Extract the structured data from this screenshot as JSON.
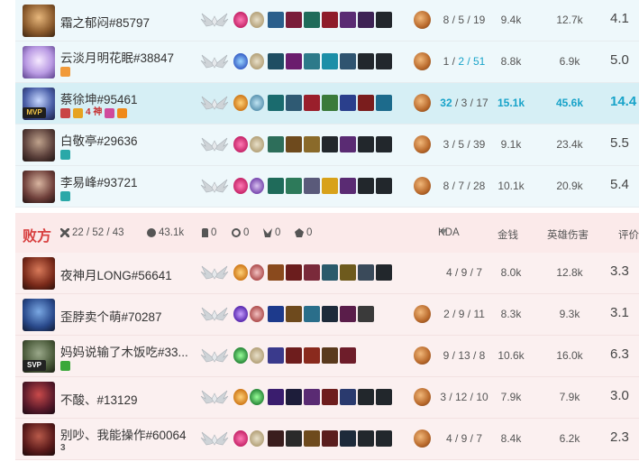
{
  "colors": {
    "win_row": "#eef8fb",
    "mvp_row": "#d6eff5",
    "lose_row": "#fbf0f0",
    "lose_label": "#d84040",
    "mvp_stat": "#18a3c9"
  },
  "win_players": [
    {
      "name": "霜之郁闷#85797",
      "kda": "8 / 5 / 19",
      "gold": "9.4k",
      "damage": "12.7k",
      "score": "4.1"
    },
    {
      "name": "云淡月明花眠#38847",
      "kda_k": "1 / ",
      "kda_d": "2 / 51",
      "gold": "8.8k",
      "damage": "6.9k",
      "score": "5.0"
    },
    {
      "name": "蔡徐坤#95461",
      "badge": "MVP",
      "tag_text": "4 神",
      "kda": "32 / 3 / 17",
      "gold": "15.1k",
      "damage": "45.6k",
      "score": "14.4"
    },
    {
      "name": "白敬亭#29636",
      "kda": "3 / 5 / 39",
      "gold": "9.1k",
      "damage": "23.4k",
      "score": "5.5"
    },
    {
      "name": "李易峰#93721",
      "kda": "8 / 7 / 28",
      "gold": "10.1k",
      "damage": "20.9k",
      "score": "5.4"
    }
  ],
  "lose_team": {
    "label": "败方",
    "kills": "22 / 52 / 43",
    "gold": "43.1k",
    "towers": "0",
    "inhibitors": "0",
    "barons": "0",
    "dragons": "0",
    "columns": {
      "kda": "KDA",
      "gold": "金钱",
      "damage": "英雄伤害",
      "score": "评价"
    }
  },
  "lose_players": [
    {
      "name": "夜神月LONG#56641",
      "kda": "4 / 9 / 7",
      "gold": "8.0k",
      "damage": "12.8k",
      "score": "3.3"
    },
    {
      "name": "歪脖卖个萌#70287",
      "kda": "2 / 9 / 11",
      "gold": "8.3k",
      "damage": "9.3k",
      "score": "3.1"
    },
    {
      "name": "妈妈说输了木饭吃#33...",
      "badge": "SVP",
      "kda": "9 / 13 / 8",
      "gold": "10.6k",
      "damage": "16.0k",
      "score": "6.3"
    },
    {
      "name": "不酸、#13129",
      "kda": "3 / 12 / 10",
      "gold": "7.9k",
      "damage": "7.9k",
      "score": "3.0"
    },
    {
      "name": "别吵、我能操作#60064",
      "tag_text": "3",
      "kda": "4 / 9 / 7",
      "gold": "8.4k",
      "damage": "6.2k",
      "score": "2.3"
    }
  ]
}
